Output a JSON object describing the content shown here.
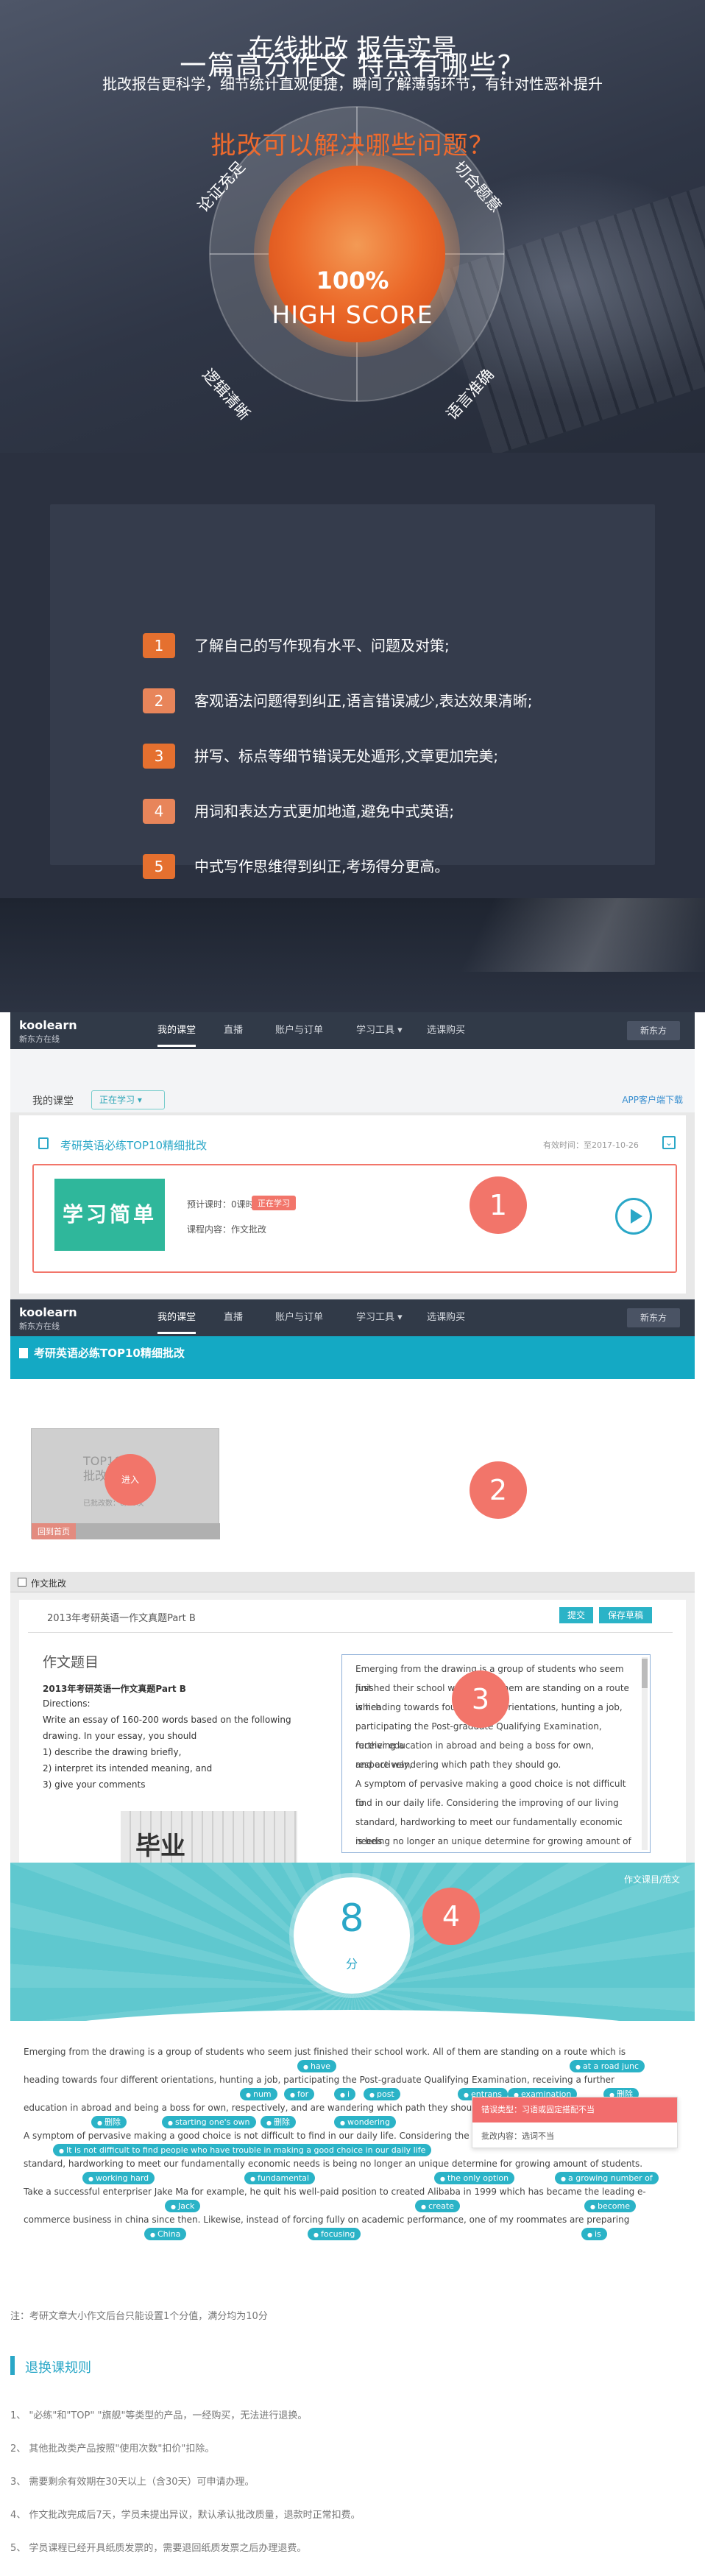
{
  "features": {
    "title": "一篇高分作文 特点有哪些？",
    "quadrants": [
      "论证充足",
      "切合题意",
      "逻辑清晰",
      "语言准确"
    ],
    "score_percent": "100%",
    "score_label": "HIGH SCORE",
    "accent_color": "#ee6a2d"
  },
  "problems": {
    "title": "批改可以解决哪些问题？",
    "items": [
      {
        "num": "1",
        "text": "了解自己的写作现有水平、问题及对策;",
        "color": "#e5702f"
      },
      {
        "num": "2",
        "text": "客观语法问题得到纠正,语言错误减少,表达效果清晰;",
        "color": "#e8855a"
      },
      {
        "num": "3",
        "text": "拼写、标点等细节错误无处遁形,文章更加完美;",
        "color": "#e5702f"
      },
      {
        "num": "4",
        "text": "用词和表达方式更加地道,避免中式英语;",
        "color": "#e8855a"
      },
      {
        "num": "5",
        "text": "中式写作思维得到纠正,考场得分更高。",
        "color": "#e5702f"
      }
    ]
  },
  "report": {
    "title": "在线批改 报告实景",
    "subtitle": "批改报告更科学，细节统计直观便捷，瞬间了解薄弱环节，有针对性恶补提升"
  },
  "nav": {
    "logo": "koolearn",
    "logo_sub": "新东方在线",
    "items": [
      "我的课堂",
      "直播",
      "账户与订单",
      "学习工具 ▾",
      "选课购买"
    ],
    "button": "新东方"
  },
  "panel1": {
    "step": "1",
    "my_class": "我的课堂",
    "learning": "正在学习 ▾",
    "app_download": "APP客户端下载",
    "course_title": "考研英语必练TOP10精细批改",
    "valid": "有效时间：至2017-10-26",
    "thumb_text": "学习简单",
    "progress": "预计课时：0课时",
    "badge": "正在学习",
    "content": "课程内容：作文批改"
  },
  "panel2": {
    "step": "2",
    "bar_title": "考研英语必练TOP10精细批改",
    "thumb_line1": "TOP10精",
    "thumb_line2": "批改育",
    "thumb_line3": "已批改数：0/10次",
    "thumb_tag": "回到首页",
    "enter": "进入"
  },
  "panel3": {
    "step": "3",
    "top_label": "作文批改",
    "title": "2013年考研英语一作文真题Part B",
    "submit": "提交",
    "save_draft": "保存草稿",
    "heading": "作文题目",
    "lines": [
      {
        "text": "2013年考研英语一作文真题Part B",
        "bold": true
      },
      {
        "text": "Directions:",
        "bold": false
      },
      {
        "text": "Write an essay of 160-200 words based on the following",
        "bold": false
      },
      {
        "text": "drawing. In your essay, you should",
        "bold": false
      },
      {
        "text": "1) describe the drawing briefly,",
        "bold": false
      },
      {
        "text": "2) interpret its intended meaning, and",
        "bold": false
      },
      {
        "text": "3) give your comments",
        "bold": false
      }
    ],
    "image_text": "毕业",
    "essay": [
      "Emerging from the drawing is a group of students who seem just",
      "finished their school work. All of them are standing on a route which",
      "is heading towards four different orientations, hunting a job,",
      "participating the Post-graduate Qualifying Examination, receiving a",
      "further education in abroad and being a boss for own, respectively,",
      "and are wandering which path they should go.",
      "A symptom of pervasive making a good choice is not difficult to",
      "find in our daily life. Considering the improving of our living",
      "standard, hardworking to meet our fundamentally economic needs",
      "is being no longer an unique determine for growing amount of"
    ]
  },
  "panel4": {
    "step": "4",
    "back_link": "作文课目/范文",
    "score": "8",
    "score_unit": "分",
    "text_lines": [
      "Emerging from the drawing is a group of students who seem just finished their school work. All of them are standing on a route which is",
      "heading towards four different orientations, hunting a job, participating the Post-graduate Qualifying Examination, receiving a further",
      "education in abroad and being a boss for own, respectively, and are wandering which path they should go.",
      "A symptom of pervasive making a good choice is not difficult to find in our daily life. Considering the improving of our living",
      "standard, hardworking to meet our fundamentally economic needs is being no longer an unique determine for growing amount of students.",
      "Take a successful enterpriser Jake Ma for example, he quit his well-paid position to created Alibaba in 1999 which has became the leading e-",
      "commerce business in china since then. Likewise, instead of forcing fully on academic performance, one of my roommates are preparing"
    ],
    "pills": [
      "have",
      "at a road junc",
      "num",
      "for",
      "i",
      "post",
      "entrans",
      "examination",
      "删除",
      "删除",
      "starting one's own",
      "删除",
      "wondering",
      "It is not difficult to find people who have trouble in making a good choice in our daily life",
      "working hard",
      "fundamental",
      "the only option",
      "a growing number of",
      "Jack",
      "create",
      "become",
      "China",
      "focusing",
      "is"
    ],
    "popup_head": "错误类型：习语或固定搭配不当",
    "popup_body": "批改内容：选词不当"
  },
  "footer": {
    "note": "注：考研文章大小作文后台只能设置1个分值，满分均为10分",
    "rules_title": "退换课规则",
    "rules": [
      "1、 \"必练\"和\"TOP\" \"旗舰\"等类型的产品，一经购买，无法进行退换。",
      "2、 其他批改类产品按照\"使用次数\"扣价\"扣除。",
      "3、 需要剩余有效期在30天以上（含30天）可申请办理。",
      "4、 作文批改完成后7天，学员未提出异议，默认承认批改质量，退款时正常扣费。",
      "5、 学员课程已经开具纸质发票的，需要退回纸质发票之后办理退费。"
    ],
    "accent_color": "#2aa7c7"
  }
}
